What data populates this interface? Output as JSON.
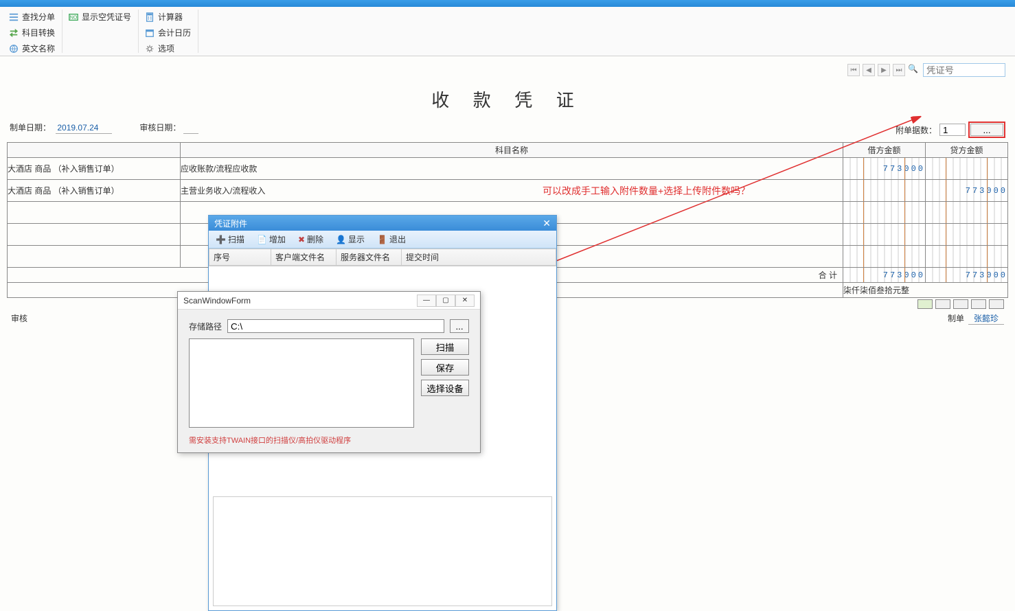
{
  "ribbon": {
    "find_split": "查找分单",
    "subject_convert": "科目转换",
    "english_name": "英文名称",
    "show_empty_voucher": "显示空凭证号",
    "calculator": "计算器",
    "accounting_calendar": "会计日历",
    "options": "选项"
  },
  "nav": {
    "search_placeholder": "凭证号"
  },
  "voucher": {
    "title": "收 款 凭 证",
    "date_label": "制单日期：",
    "date_value": "2019.07.24",
    "audit_date_label": "审核日期：",
    "audit_date_value": "",
    "attach_label": "附单据数：",
    "attach_count": "1",
    "attach_btn": "...",
    "headers": {
      "summary": "",
      "account": "科目名称",
      "debit": "借方金额",
      "credit": "贷方金额"
    },
    "rows": [
      {
        "summary": "大酒店 商品 （补入销售订单）",
        "account": "应收账款/流程应收款",
        "debit": "773000",
        "credit": ""
      },
      {
        "summary": "大酒店 商品 （补入销售订单）",
        "account": "主营业务收入/流程收入",
        "debit": "",
        "credit": "773000"
      },
      {
        "summary": "",
        "account": "",
        "debit": "",
        "credit": ""
      },
      {
        "summary": "",
        "account": "",
        "debit": "",
        "credit": ""
      },
      {
        "summary": "",
        "account": "",
        "debit": "",
        "credit": ""
      }
    ],
    "total_label": "合 计",
    "total_debit": "773000",
    "total_credit": "773000",
    "amount_words": "柒仟柒佰叁拾元整",
    "footer": {
      "audit_label": "审核",
      "maker_label": "制单",
      "maker_name": "张懿珍"
    }
  },
  "annotation": {
    "text": "可以改成手工输入附件数量+选择上传附件数吗？"
  },
  "dialog_attach": {
    "title": "凭证附件",
    "toolbar": {
      "scan": "扫描",
      "add": "增加",
      "delete": "删除",
      "show": "显示",
      "exit": "退出"
    },
    "cols": {
      "seq": "序号",
      "client_file": "客户端文件名",
      "server_file": "服务器文件名",
      "submit_time": "提交时间"
    }
  },
  "dialog_scan": {
    "title": "ScanWindowForm",
    "path_label": "存储路径",
    "path_value": "C:\\",
    "browse": "...",
    "btn_scan": "扫描",
    "btn_save": "保存",
    "btn_device": "选择设备",
    "note": "需安装支持TWAIN接口的扫描仪/高拍仪驱动程序"
  }
}
